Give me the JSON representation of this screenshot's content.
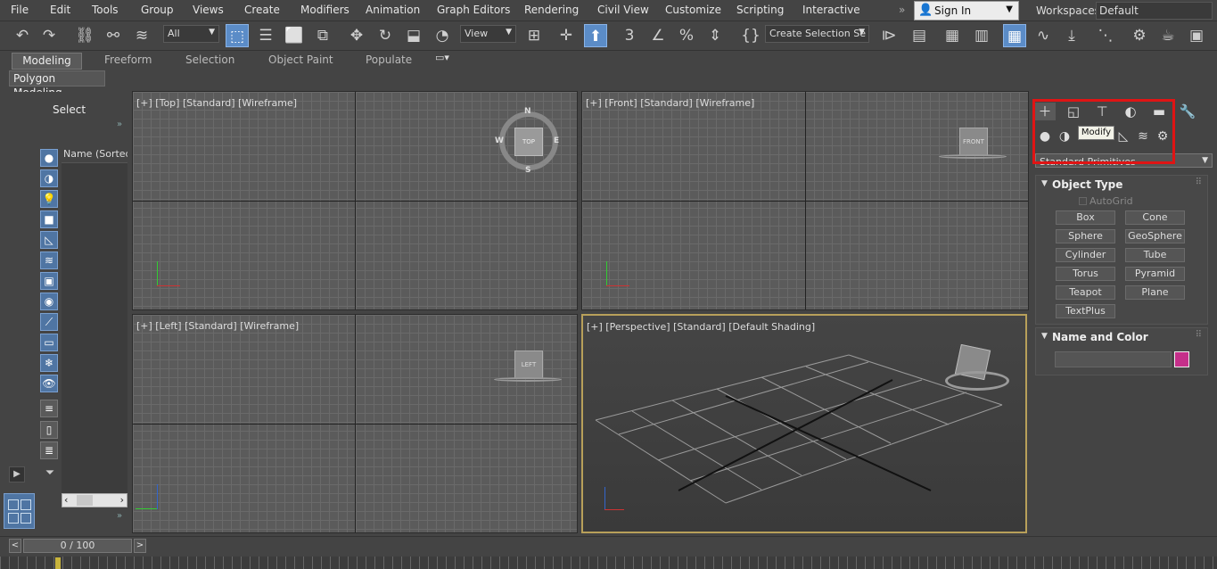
{
  "menubar": {
    "items": [
      "File",
      "Edit",
      "Tools",
      "Group",
      "Views",
      "Create",
      "Modifiers",
      "Animation",
      "Graph Editors",
      "Rendering",
      "Civil View",
      "Customize",
      "Scripting",
      "Interactive"
    ],
    "sign_in": "Sign In",
    "workspaces_label": "Workspaces:",
    "workspace_value": "Default"
  },
  "toolbar": {
    "selection_filter": "All",
    "ref_coord": "View",
    "selection_set": "Create Selection Se"
  },
  "ribbon": {
    "tabs": [
      "Modeling",
      "Freeform",
      "Selection",
      "Object Paint",
      "Populate"
    ],
    "sub_panel": "Polygon Modeling"
  },
  "scene_explorer": {
    "select_label": "Select",
    "column_header": "Name (Sorted A"
  },
  "viewports": {
    "top": "[+] [Top] [Standard] [Wireframe]",
    "front": "[+] [Front] [Standard] [Wireframe]",
    "left": "[+] [Left] [Standard] [Wireframe]",
    "perspective": "[+] [Perspective] [Standard] [Default Shading]",
    "top_cube": "TOP",
    "front_cube": "FRONT",
    "left_cube": "LEFT",
    "compass": {
      "n": "N",
      "s": "S",
      "e": "E",
      "w": "W"
    }
  },
  "command_panel": {
    "tooltip": "Modify",
    "primitives_dropdown": "Standard Primitives",
    "object_type_title": "Object Type",
    "autogrid": "AutoGrid",
    "buttons": [
      "Box",
      "Cone",
      "Sphere",
      "GeoSphere",
      "Cylinder",
      "Tube",
      "Torus",
      "Pyramid",
      "Teapot",
      "Plane",
      "TextPlus"
    ],
    "name_color_title": "Name and Color",
    "swatch_color": "#c52f8a"
  },
  "timeline": {
    "frame_label": "0 / 100",
    "prev": "<",
    "next": ">"
  },
  "colors": {
    "highlight_box": "#e01414",
    "active_blue": "#5b8cc7"
  }
}
